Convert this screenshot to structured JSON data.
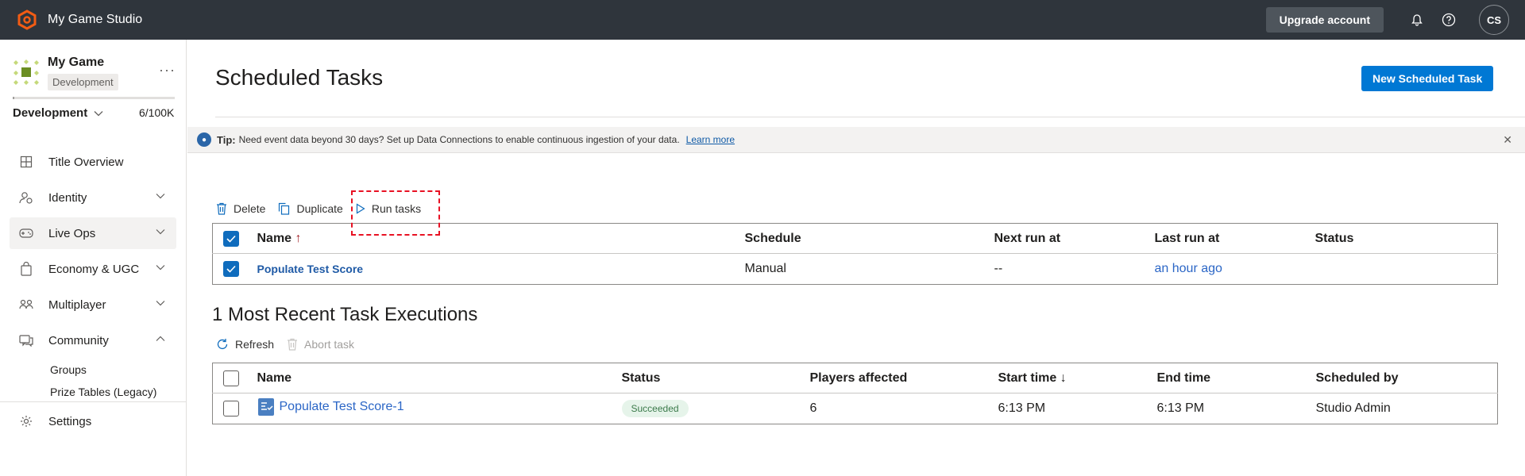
{
  "app": {
    "title": "My Game Studio"
  },
  "topbar": {
    "upgrade_label": "Upgrade account",
    "avatar_initials": "CS",
    "icons": [
      "bell-icon",
      "help-icon"
    ]
  },
  "game": {
    "name": "My Game",
    "environment_tag": "Development",
    "usage_fraction": 6e-05
  },
  "environment": {
    "selected": "Development",
    "usage": "6/100K"
  },
  "sidebar": {
    "items": [
      {
        "label": "Title Overview",
        "icon": "grid-icon"
      },
      {
        "label": "Identity",
        "icon": "identity-icon"
      },
      {
        "label": "Live Ops",
        "icon": "gamepad-icon"
      },
      {
        "label": "Economy & UGC",
        "icon": "bag-icon"
      },
      {
        "label": "Multiplayer",
        "icon": "people-icon"
      },
      {
        "label": "Community",
        "icon": "chat-icon"
      }
    ],
    "community_sub": [
      "Groups",
      "Prize Tables (Legacy)"
    ],
    "settings_label": "Settings"
  },
  "page": {
    "title": "Scheduled Tasks",
    "new_button": "New Scheduled Task"
  },
  "tip": {
    "label": "Tip:",
    "text": "Need event data beyond 30 days? Set up Data Connections to enable continuous ingestion of your data.",
    "link": "Learn more"
  },
  "toolbar": {
    "delete": "Delete",
    "duplicate": "Duplicate",
    "run": "Run tasks"
  },
  "tasks_table": {
    "columns": [
      "Name",
      "Schedule",
      "Next run at",
      "Last run at",
      "Status"
    ],
    "rows": [
      {
        "name": "Populate Test Score",
        "schedule": "Manual",
        "next_run": "--",
        "last_run": "an hour ago",
        "status": ""
      }
    ]
  },
  "executions": {
    "title": "1 Most Recent Task Executions",
    "refresh": "Refresh",
    "abort": "Abort task",
    "columns": [
      "Name",
      "Status",
      "Players affected",
      "Start time",
      "End time",
      "Scheduled by"
    ],
    "rows": [
      {
        "name": "Populate Test Score-1",
        "status": "Succeeded",
        "players": "6",
        "start": "6:13 PM",
        "end": "6:13 PM",
        "by": "Studio Admin"
      }
    ]
  },
  "colors": {
    "accent": "#0078d4",
    "topbar": "#2f353c",
    "highlight": "#e81123",
    "success_bg": "#e6f4ea"
  }
}
